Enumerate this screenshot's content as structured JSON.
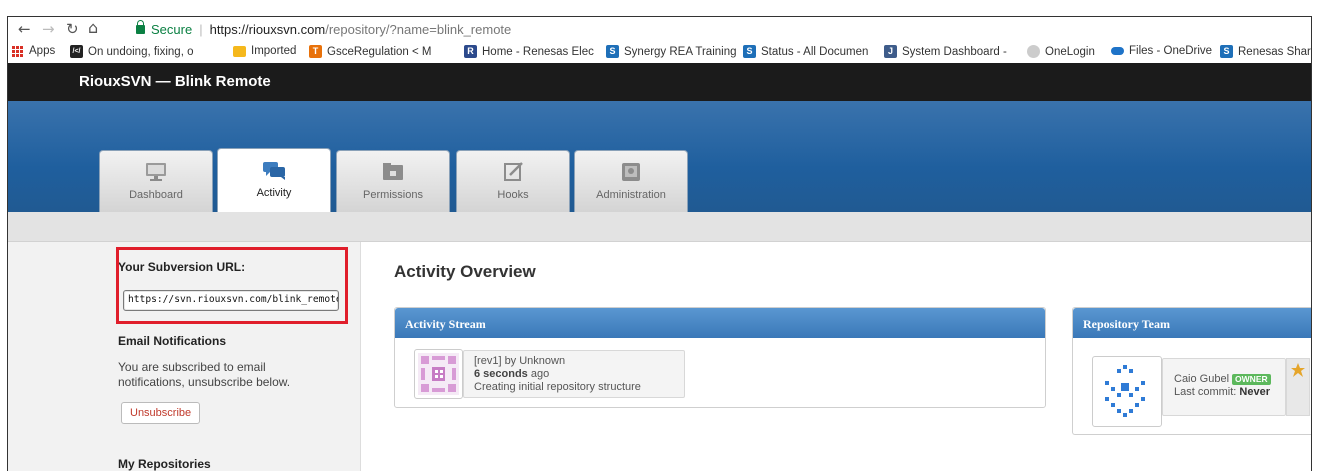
{
  "browser": {
    "secure_label": "Secure",
    "url_host": "https://riouxsvn.com",
    "url_path": "/repository/?name=blink_remote"
  },
  "bookmarks": [
    {
      "label": "Apps",
      "icon": "apps-grid-icon"
    },
    {
      "label": "On undoing, fixing, o",
      "icon": "site-favicon"
    },
    {
      "label": "Imported",
      "icon": "folder-icon"
    },
    {
      "label": "GsceRegulation < M",
      "icon": "site-favicon"
    },
    {
      "label": "Home - Renesas Elec",
      "icon": "renesas-icon"
    },
    {
      "label": "Synergy REA Training",
      "icon": "sharepoint-icon"
    },
    {
      "label": "Status - All Documen",
      "icon": "sharepoint-icon"
    },
    {
      "label": "System Dashboard -",
      "icon": "jira-icon"
    },
    {
      "label": "OneLogin",
      "icon": "onelogin-icon"
    },
    {
      "label": "Files - OneDrive",
      "icon": "onedrive-icon"
    },
    {
      "label": "Renesas Share",
      "icon": "sharepoint-icon"
    }
  ],
  "site": {
    "title": "RiouxSVN — Blink Remote",
    "tabs": [
      {
        "label": "Dashboard",
        "icon": "monitor-icon"
      },
      {
        "label": "Activity",
        "icon": "chat-bubbles-icon"
      },
      {
        "label": "Permissions",
        "icon": "folder-lock-icon"
      },
      {
        "label": "Hooks",
        "icon": "edit-icon"
      },
      {
        "label": "Administration",
        "icon": "safe-icon"
      }
    ]
  },
  "sidebar": {
    "svn_url_heading": "Your Subversion URL:",
    "svn_url_value": "https://svn.riouxsvn.com/blink_remote",
    "email_heading": "Email Notifications",
    "email_text": "You are subscribed to email notifications, unsubscribe below.",
    "unsubscribe_label": "Unsubscribe",
    "repos_heading": "My Repositories"
  },
  "main": {
    "title": "Activity Overview",
    "stream": {
      "heading": "Activity Stream",
      "item": {
        "rev_line": "[rev1] by Unknown",
        "time_bold": "6 seconds",
        "time_rest": " ago",
        "message": "Creating initial repository structure"
      }
    },
    "team": {
      "heading": "Repository Team",
      "member": {
        "name": "Caio Gubel",
        "badge": "OWNER",
        "commit_prefix": "Last commit: ",
        "commit_value": "Never"
      }
    }
  },
  "colors": {
    "accent_blue": "#2a66a6",
    "highlight_red": "#e01e2b",
    "owner_green": "#5cb85c"
  }
}
